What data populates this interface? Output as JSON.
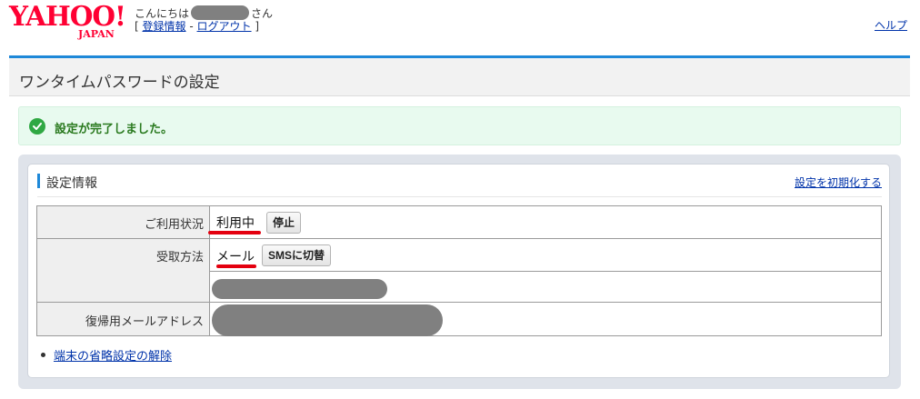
{
  "header": {
    "logo_main": "YAHOO!",
    "logo_sub": "JAPAN",
    "greeting_prefix": "こんにちは",
    "greeting_suffix": "さん",
    "bracket_open": "[",
    "register_info_link": "登録情報",
    "separator": "-",
    "logout_link": "ログアウト",
    "bracket_close": "]",
    "help_link": "ヘルプ"
  },
  "page": {
    "title": "ワンタイムパスワードの設定"
  },
  "success": {
    "icon": "check-circle-icon",
    "message": "設定が完了しました。",
    "color": "#2fa843"
  },
  "settings": {
    "section_title": "設定情報",
    "reset_link": "設定を初期化する",
    "rows": [
      {
        "label": "ご利用状況",
        "value": "利用中",
        "button": "停止"
      },
      {
        "label": "受取方法",
        "value": "メール",
        "button": "SMSに切替"
      },
      {
        "label": "復帰用メールアドレス"
      }
    ],
    "links": [
      {
        "label": "端末の省略設定の解除"
      }
    ]
  },
  "colors": {
    "brand": "#ff0033",
    "accent": "#1e88d8",
    "link": "#0033aa",
    "highlight": "#e4000f"
  }
}
